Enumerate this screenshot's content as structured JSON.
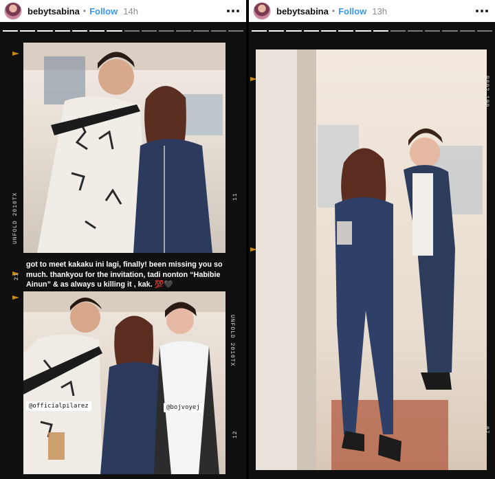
{
  "stories": [
    {
      "username": "bebytsabina",
      "follow_label": "Follow",
      "time": "14h",
      "caption": "got to meet kakaku ini lagi, finally! been missing you so much. thankyou for the invitation, tadi nonton “Habibie Ainun”  & as always u killing it , kak. 💯🖤",
      "tags": [
        "@officialpilarez",
        "@bojvoyej"
      ],
      "film_marks": [
        "UNFOLD 2010TX",
        "UNFOLD 2010TX",
        "11",
        "21",
        "12"
      ]
    },
    {
      "username": "bebytsabina",
      "follow_label": "Follow",
      "time": "13h",
      "film_marks": [
        "P802 190",
        "07"
      ]
    }
  ],
  "colors": {
    "follow": "#3897f0",
    "sprocket": "#c68a1a"
  },
  "icons": [
    "more-options-icon",
    "avatar"
  ]
}
